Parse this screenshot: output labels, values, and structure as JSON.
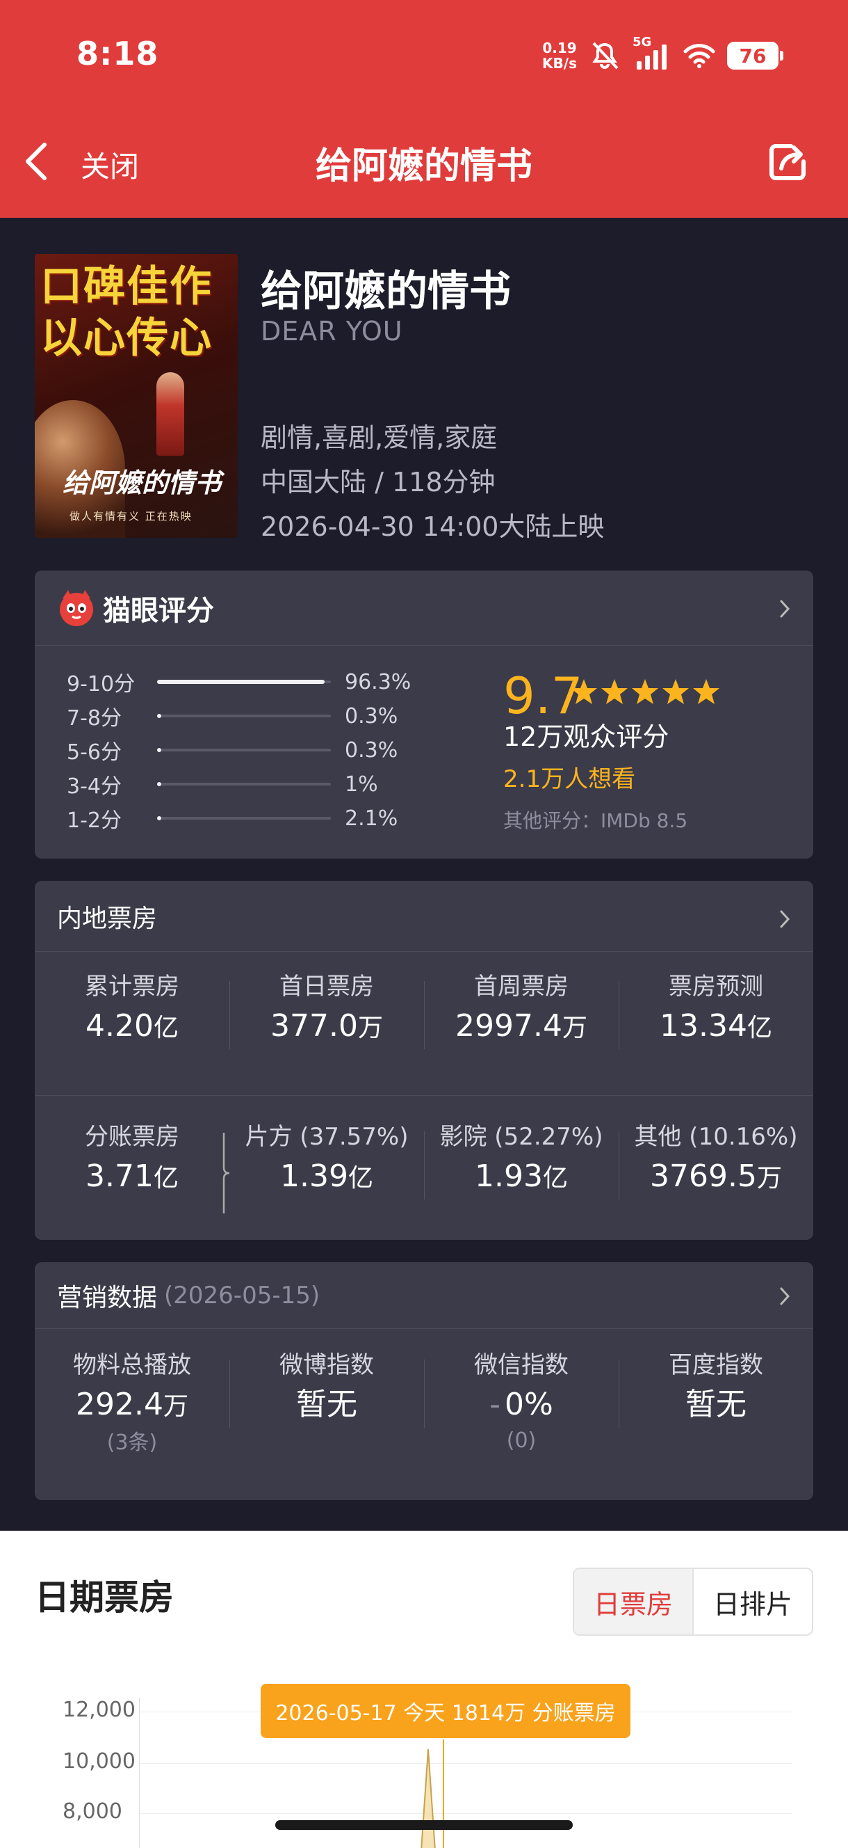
{
  "status_bar": {
    "time": "8:18",
    "net_speed_value": "0.19",
    "net_speed_unit": "KB/s",
    "network": "5G",
    "battery": "76"
  },
  "nav": {
    "close_label": "关闭",
    "title": "给阿嬷的情书"
  },
  "movie": {
    "poster_tagline_line1": "口碑佳作",
    "poster_tagline_line2": "以心传心",
    "poster_title": "给阿嬷的情书",
    "poster_subtitle": "做人有情有义  正在热映",
    "title": "给阿嬷的情书",
    "english_title": "DEAR YOU",
    "genres": "剧情,喜剧,爱情,家庭",
    "region_duration": "中国大陆 / 118分钟",
    "release": "2026-04-30 14:00大陆上映"
  },
  "rating": {
    "section_title": "猫眼评分",
    "score": "9.7",
    "stars": 5,
    "audience_count": "12万观众评分",
    "want_to_see": "2.1万人想看",
    "other_ratings": "其他评分：IMDb 8.5",
    "distribution": [
      {
        "label": "9-10分",
        "percent_text": "96.3%",
        "value": 96.3
      },
      {
        "label": "7-8分",
        "percent_text": "0.3%",
        "value": 0.3
      },
      {
        "label": "5-6分",
        "percent_text": "0.3%",
        "value": 0.3
      },
      {
        "label": "3-4分",
        "percent_text": "1%",
        "value": 1
      },
      {
        "label": "1-2分",
        "percent_text": "2.1%",
        "value": 2.1
      }
    ]
  },
  "box_office": {
    "section_title": "内地票房",
    "stats": [
      {
        "label": "累计票房",
        "value": "4.20",
        "unit": "亿"
      },
      {
        "label": "首日票房",
        "value": "377.0",
        "unit": "万"
      },
      {
        "label": "首周票房",
        "value": "2997.4",
        "unit": "万"
      },
      {
        "label": "票房预测",
        "value": "13.34",
        "unit": "亿"
      }
    ],
    "split": [
      {
        "label": "分账票房",
        "value": "3.71",
        "unit": "亿"
      },
      {
        "label": "片方 (37.57%)",
        "value": "1.39",
        "unit": "亿"
      },
      {
        "label": "影院 (52.27%)",
        "value": "1.93",
        "unit": "亿"
      },
      {
        "label": "其他 (10.16%)",
        "value": "3769.5",
        "unit": "万"
      }
    ]
  },
  "marketing": {
    "section_title": "营销数据",
    "date": "(2026-05-15)",
    "stats": [
      {
        "label": "物料总播放",
        "value": "292.4",
        "unit": "万",
        "note": "(3条)"
      },
      {
        "label": "微博指数",
        "value": "暂无",
        "unit": "",
        "note": ""
      },
      {
        "label": "微信指数",
        "value": "0%",
        "unit": "",
        "note": "(0)",
        "prefix": "-"
      },
      {
        "label": "百度指数",
        "value": "暂无",
        "unit": "",
        "note": ""
      }
    ]
  },
  "daily": {
    "title": "日期票房",
    "toggle": [
      "日票房",
      "日排片"
    ],
    "active_toggle": 0,
    "tooltip": "2026-05-17 今天 1814万 分账票房",
    "y_ticks": [
      "12,000",
      "10,000",
      "8,000"
    ]
  },
  "colors": {
    "header_red": "#e03c3b",
    "page_bg": "#1d1c2a",
    "card_bg": "#3c3b49",
    "accent_orange": "#fcb41e",
    "tooltip_orange": "#f9a21b"
  }
}
